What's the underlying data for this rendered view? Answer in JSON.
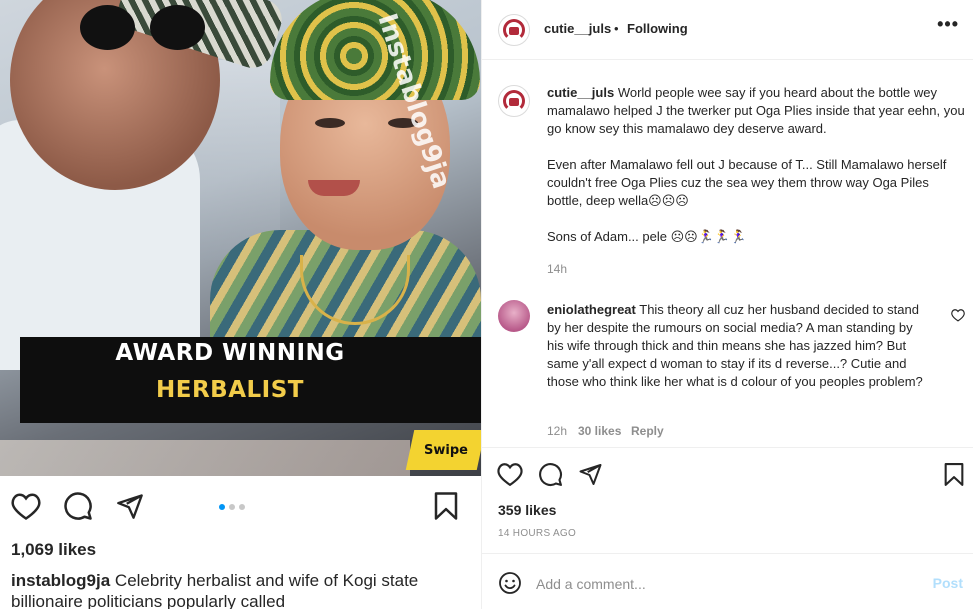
{
  "post": {
    "watermark": "Instablog9ja",
    "banner_line1": "AWARD WINNING",
    "banner_line2": "HERBALIST",
    "swipe_label": "Swipe",
    "carousel_index": 1,
    "carousel_count": 3,
    "likes_left": "1,069 likes",
    "caption_user": "instablog9ja",
    "caption_text": "Celebrity herbalist and wife of Kogi state billionaire politicians popularly called"
  },
  "header": {
    "username": "cutie__juls",
    "separator": "•",
    "following_label": "Following",
    "more_icon": "more-horizontal-icon",
    "more_glyph": "•••"
  },
  "comments": [
    {
      "user": "cutie__juls",
      "paragraphs": [
        "World people wee say if you heard about the bottle wey mamalawo helped J the twerker put Oga Plies inside that year eehn, you go know sey this mamalawo dey deserve award.",
        "Even after Mamalawo fell out J because of T... Still Mamalawo herself couldn't free Oga Plies cuz the sea wey them throw way Oga Piles bottle, deep wella☹☹☹",
        "Sons of Adam... pele ☹☹🏃‍♀️🏃‍♀️🏃‍♀️"
      ],
      "time": "14h"
    },
    {
      "user": "eniolathegreat",
      "text": "This theory all cuz her husband decided to stand by her despite the rumours on social media? A man standing by his wife through thick and thin means she has jazzed him? But same y'all expect d woman to stay if its d reverse...? Cutie and those who think like her what is d colour of you peoples problem?",
      "time": "12h",
      "likes": "30 likes",
      "reply_label": "Reply"
    }
  ],
  "footer": {
    "likes": "359 likes",
    "time": "14 HOURS AGO",
    "comment_placeholder": "Add a comment...",
    "post_label": "Post"
  },
  "colors": {
    "accent": "#0095f6",
    "post_disabled": "#b2dffc",
    "muted": "#8e8e8e",
    "text": "#262626",
    "banner_yellow": "#f2cc4a"
  }
}
